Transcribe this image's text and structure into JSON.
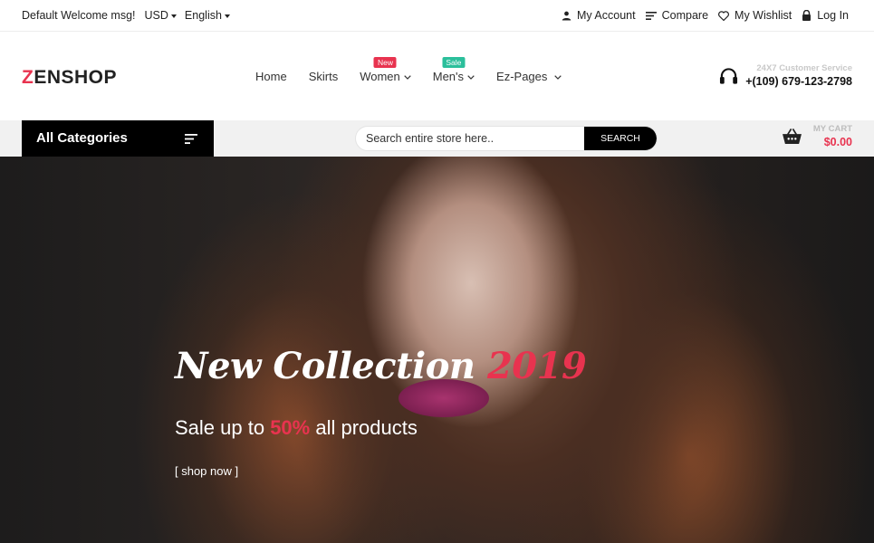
{
  "topbar": {
    "welcome": "Default Welcome msg!",
    "currency": "USD",
    "language": "English",
    "links": {
      "account": "My Account",
      "compare": "Compare",
      "wishlist": "My Wishlist",
      "login": "Log In"
    }
  },
  "header": {
    "logo_first": "Z",
    "logo_rest": "ENSHOP",
    "nav": {
      "home": "Home",
      "skirts": "Skirts",
      "women": "Women",
      "women_badge": "New",
      "mens": "Men's",
      "mens_badge": "Sale",
      "ezpages": "Ez-Pages"
    },
    "support": {
      "label": "24X7 Customer Service",
      "phone": "+(109) 679-123-2798"
    }
  },
  "catbar": {
    "all_categories": "All Categories",
    "search_placeholder": "Search entire store here..",
    "search_button": "SEARCH",
    "cart_label": "MY CART",
    "cart_amount": "$0.00"
  },
  "hero": {
    "title_main": "New Collection ",
    "title_year": "2019",
    "subtitle_prefix": "Sale up to ",
    "subtitle_percent": "50%",
    "subtitle_suffix": " all products",
    "cta": "[ shop now ]"
  },
  "colors": {
    "accent": "#e8334f",
    "sale_badge": "#2bbf9b",
    "dark": "#000000"
  },
  "icons": [
    "caret-down-icon",
    "user-icon",
    "compare-icon",
    "heart-icon",
    "lock-icon",
    "chevron-down-icon",
    "headphones-icon",
    "menu-lines-icon",
    "basket-icon"
  ]
}
